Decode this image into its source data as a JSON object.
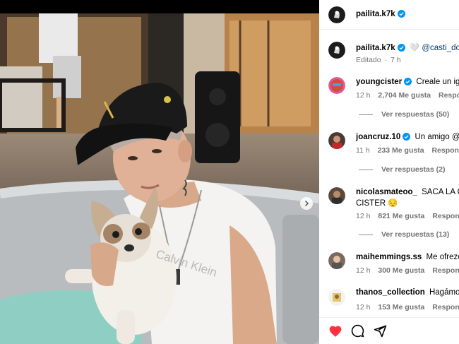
{
  "post": {
    "author": "pailita.k7k",
    "caption_author": "pailita.k7k",
    "caption_heart": "🤍",
    "caption_mention": "@casti_dog",
    "caption_edited": "Editado",
    "caption_time": "7 h"
  },
  "comments": [
    {
      "username": "youngcister",
      "text": "Creale un ig",
      "time": "12 h",
      "likes": "2,704 Me gusta",
      "reply_label": "Responder",
      "view_replies": "Ver respuestas (50)",
      "verified": true
    },
    {
      "username": "joancruz.10",
      "text": "Un amigo @ro",
      "time": "11 h",
      "likes": "233 Me gusta",
      "reply_label": "Responder",
      "view_replies": "Ver respuestas (2)",
      "verified": true
    },
    {
      "username": "nicolasmateoo_",
      "text": "SACA LA CA",
      "text_line2": "CISTER 😔",
      "time": "12 h",
      "likes": "821 Me gusta",
      "reply_label": "Responder",
      "view_replies": "Ver respuestas (13)",
      "verified": false
    },
    {
      "username": "maihemmings.ss",
      "text": "Me ofrezco",
      "time": "12 h",
      "likes": "300 Me gusta",
      "reply_label": "Responder",
      "verified": false
    },
    {
      "username": "thanos_collection",
      "text": "Hagámosl",
      "time": "12 h",
      "likes": "153 Me gusta",
      "reply_label": "Responder",
      "verified": false
    }
  ],
  "photo_texts": {
    "shirt_logo": "Calvin Klein"
  },
  "colors": {
    "like_red": "#ff3040",
    "verified_blue": "#0095f6",
    "meta_gray": "#737373"
  },
  "icons": {
    "like": "heart-icon",
    "comment": "comment-icon",
    "share": "share-icon",
    "verified": "verified-badge-icon",
    "next": "chevron-right-icon"
  }
}
